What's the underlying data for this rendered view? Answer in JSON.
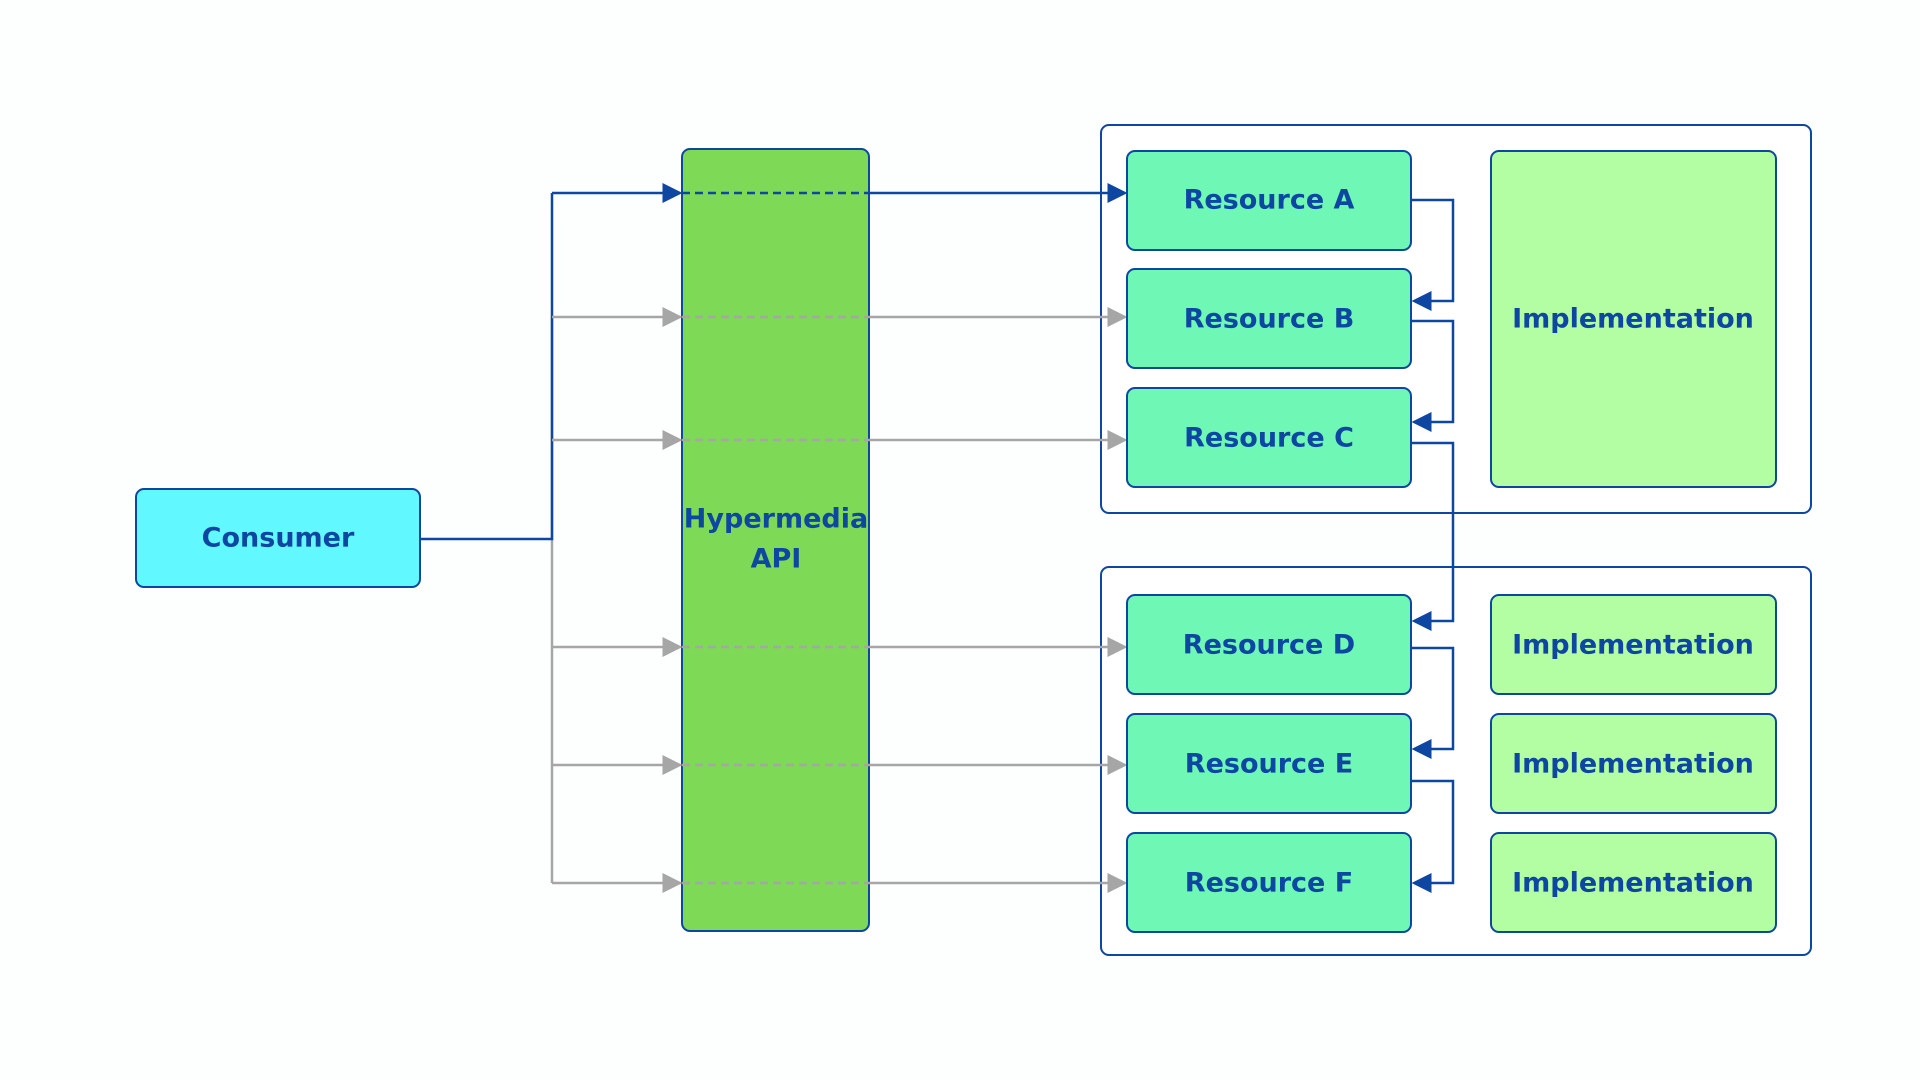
{
  "consumer": {
    "label": "Consumer",
    "color": "#62f8ff"
  },
  "api": {
    "label_line1": "Hypermedia",
    "label_line2": "API",
    "color": "#7ed957"
  },
  "resources": [
    {
      "label": "Resource A"
    },
    {
      "label": "Resource B"
    },
    {
      "label": "Resource C"
    },
    {
      "label": "Resource D"
    },
    {
      "label": "Resource E"
    },
    {
      "label": "Resource F"
    }
  ],
  "implementations": [
    {
      "label": "Implementation"
    },
    {
      "label": "Implementation"
    },
    {
      "label": "Implementation"
    },
    {
      "label": "Implementation"
    }
  ],
  "colors": {
    "resource": "#6ff7b5",
    "implementation": "#b3fea3",
    "stroke": "#0d47a1",
    "inactive_arrow": "#a6a6a6",
    "active_arrow": "#0d47a1"
  }
}
